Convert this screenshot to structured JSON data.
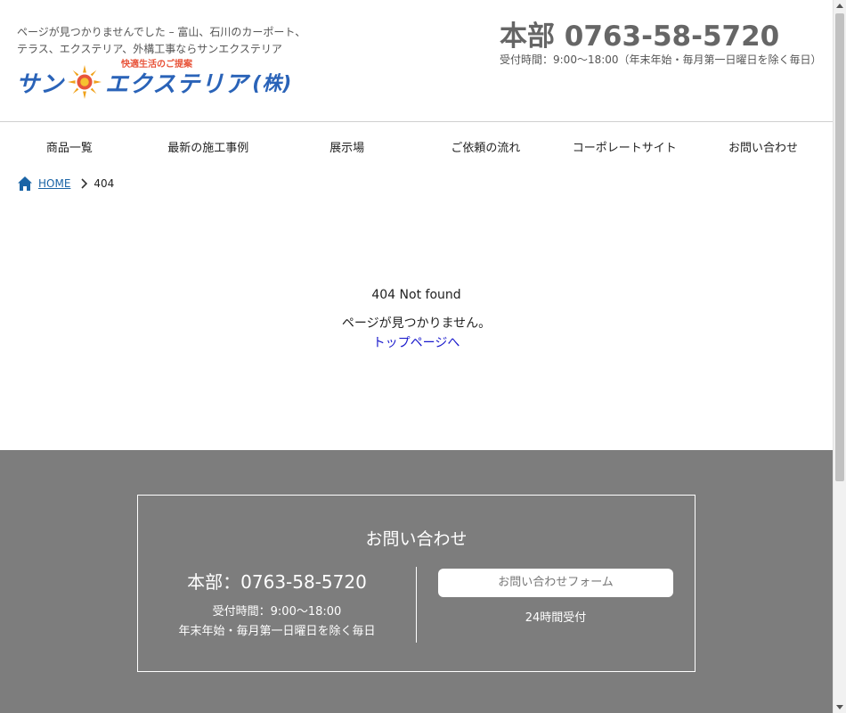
{
  "header": {
    "tagline": "ページが見つかりませんでした – 富山、石川のカーポート、テラス、エクステリア、外構工事ならサンエクステリア",
    "logo": {
      "part1": "サン",
      "part2": "エクステリア",
      "kabu": "(株)",
      "catchphrase": "快適生活のご提案"
    },
    "phone": "本部 0763-58-5720",
    "hours": "受付時間：9:00〜18:00（年末年始・毎月第一日曜日を除く毎日）"
  },
  "nav": {
    "items": [
      {
        "label": "商品一覧"
      },
      {
        "label": "最新の施工事例"
      },
      {
        "label": "展示場"
      },
      {
        "label": "ご依頼の流れ"
      },
      {
        "label": "コーポレートサイト"
      },
      {
        "label": "お問い合わせ"
      }
    ]
  },
  "breadcrumb": {
    "home": "HOME",
    "current": "404"
  },
  "main": {
    "title": "404 Not found",
    "message": "ページが見つかりません。",
    "top_link": "トップページへ"
  },
  "footer": {
    "contact_title": "お問い合わせ",
    "phone": "本部：0763-58-5720",
    "hours_line1": "受付時間：9:00〜18:00",
    "hours_line2": "年末年始・毎月第一日曜日を除く毎日",
    "form_button": "お問い合わせフォーム",
    "form_note": "24時間受付"
  },
  "colors": {
    "link": "#1a64a6",
    "footer_bg": "#7d7d7d",
    "logo_blue": "#2a63b8",
    "logo_orange": "#e8543a"
  }
}
